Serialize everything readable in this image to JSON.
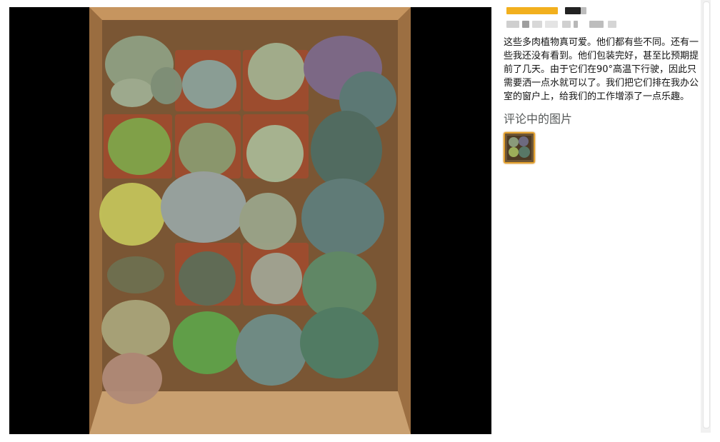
{
  "review": {
    "text": "这些多肉植物真可爱。他们都有些不同。还有一些我还没有看到。他们包装完好，甚至比预期提前了几天。由于它们在90°高温下行驶，因此只需要洒一点水就可以了。我们把它们排在我办公室的窗户上，给我们的工作增添了一点乐趣。",
    "images_heading": "评论中的图片"
  },
  "colors": {
    "viewer_bg": "#000000",
    "thumb_border": "#e3a12f",
    "rating_blur": "#f2b01e"
  },
  "icons": {
    "photo": "succulents-in-box-photo",
    "thumbnail": "review-image-thumbnail"
  }
}
